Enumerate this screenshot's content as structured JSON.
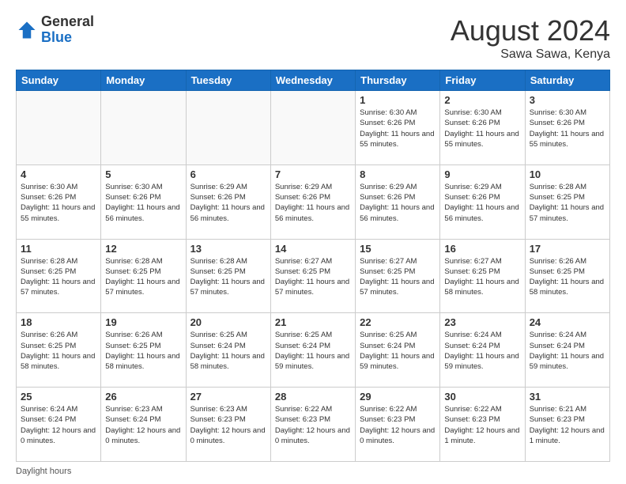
{
  "logo": {
    "general": "General",
    "blue": "Blue"
  },
  "title": "August 2024",
  "location": "Sawa Sawa, Kenya",
  "days_of_week": [
    "Sunday",
    "Monday",
    "Tuesday",
    "Wednesday",
    "Thursday",
    "Friday",
    "Saturday"
  ],
  "footer": "Daylight hours",
  "weeks": [
    [
      {
        "day": "",
        "info": ""
      },
      {
        "day": "",
        "info": ""
      },
      {
        "day": "",
        "info": ""
      },
      {
        "day": "",
        "info": ""
      },
      {
        "day": "1",
        "info": "Sunrise: 6:30 AM\nSunset: 6:26 PM\nDaylight: 11 hours and 55 minutes."
      },
      {
        "day": "2",
        "info": "Sunrise: 6:30 AM\nSunset: 6:26 PM\nDaylight: 11 hours and 55 minutes."
      },
      {
        "day": "3",
        "info": "Sunrise: 6:30 AM\nSunset: 6:26 PM\nDaylight: 11 hours and 55 minutes."
      }
    ],
    [
      {
        "day": "4",
        "info": "Sunrise: 6:30 AM\nSunset: 6:26 PM\nDaylight: 11 hours and 55 minutes."
      },
      {
        "day": "5",
        "info": "Sunrise: 6:30 AM\nSunset: 6:26 PM\nDaylight: 11 hours and 56 minutes."
      },
      {
        "day": "6",
        "info": "Sunrise: 6:29 AM\nSunset: 6:26 PM\nDaylight: 11 hours and 56 minutes."
      },
      {
        "day": "7",
        "info": "Sunrise: 6:29 AM\nSunset: 6:26 PM\nDaylight: 11 hours and 56 minutes."
      },
      {
        "day": "8",
        "info": "Sunrise: 6:29 AM\nSunset: 6:26 PM\nDaylight: 11 hours and 56 minutes."
      },
      {
        "day": "9",
        "info": "Sunrise: 6:29 AM\nSunset: 6:26 PM\nDaylight: 11 hours and 56 minutes."
      },
      {
        "day": "10",
        "info": "Sunrise: 6:28 AM\nSunset: 6:25 PM\nDaylight: 11 hours and 57 minutes."
      }
    ],
    [
      {
        "day": "11",
        "info": "Sunrise: 6:28 AM\nSunset: 6:25 PM\nDaylight: 11 hours and 57 minutes."
      },
      {
        "day": "12",
        "info": "Sunrise: 6:28 AM\nSunset: 6:25 PM\nDaylight: 11 hours and 57 minutes."
      },
      {
        "day": "13",
        "info": "Sunrise: 6:28 AM\nSunset: 6:25 PM\nDaylight: 11 hours and 57 minutes."
      },
      {
        "day": "14",
        "info": "Sunrise: 6:27 AM\nSunset: 6:25 PM\nDaylight: 11 hours and 57 minutes."
      },
      {
        "day": "15",
        "info": "Sunrise: 6:27 AM\nSunset: 6:25 PM\nDaylight: 11 hours and 57 minutes."
      },
      {
        "day": "16",
        "info": "Sunrise: 6:27 AM\nSunset: 6:25 PM\nDaylight: 11 hours and 58 minutes."
      },
      {
        "day": "17",
        "info": "Sunrise: 6:26 AM\nSunset: 6:25 PM\nDaylight: 11 hours and 58 minutes."
      }
    ],
    [
      {
        "day": "18",
        "info": "Sunrise: 6:26 AM\nSunset: 6:25 PM\nDaylight: 11 hours and 58 minutes."
      },
      {
        "day": "19",
        "info": "Sunrise: 6:26 AM\nSunset: 6:25 PM\nDaylight: 11 hours and 58 minutes."
      },
      {
        "day": "20",
        "info": "Sunrise: 6:25 AM\nSunset: 6:24 PM\nDaylight: 11 hours and 58 minutes."
      },
      {
        "day": "21",
        "info": "Sunrise: 6:25 AM\nSunset: 6:24 PM\nDaylight: 11 hours and 59 minutes."
      },
      {
        "day": "22",
        "info": "Sunrise: 6:25 AM\nSunset: 6:24 PM\nDaylight: 11 hours and 59 minutes."
      },
      {
        "day": "23",
        "info": "Sunrise: 6:24 AM\nSunset: 6:24 PM\nDaylight: 11 hours and 59 minutes."
      },
      {
        "day": "24",
        "info": "Sunrise: 6:24 AM\nSunset: 6:24 PM\nDaylight: 11 hours and 59 minutes."
      }
    ],
    [
      {
        "day": "25",
        "info": "Sunrise: 6:24 AM\nSunset: 6:24 PM\nDaylight: 12 hours and 0 minutes."
      },
      {
        "day": "26",
        "info": "Sunrise: 6:23 AM\nSunset: 6:24 PM\nDaylight: 12 hours and 0 minutes."
      },
      {
        "day": "27",
        "info": "Sunrise: 6:23 AM\nSunset: 6:23 PM\nDaylight: 12 hours and 0 minutes."
      },
      {
        "day": "28",
        "info": "Sunrise: 6:22 AM\nSunset: 6:23 PM\nDaylight: 12 hours and 0 minutes."
      },
      {
        "day": "29",
        "info": "Sunrise: 6:22 AM\nSunset: 6:23 PM\nDaylight: 12 hours and 0 minutes."
      },
      {
        "day": "30",
        "info": "Sunrise: 6:22 AM\nSunset: 6:23 PM\nDaylight: 12 hours and 1 minute."
      },
      {
        "day": "31",
        "info": "Sunrise: 6:21 AM\nSunset: 6:23 PM\nDaylight: 12 hours and 1 minute."
      }
    ]
  ]
}
